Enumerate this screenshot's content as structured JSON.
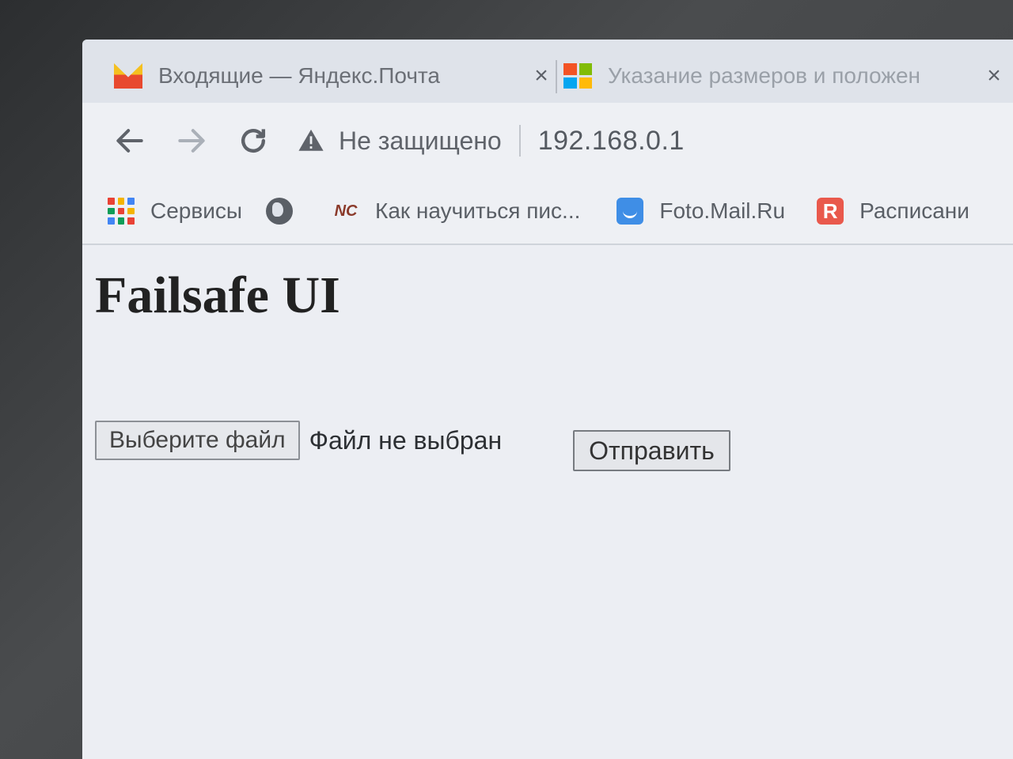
{
  "browser": {
    "tabs": [
      {
        "title": "Входящие — Яндекс.Почта",
        "close": "×",
        "favicon": "yandex-mail-icon"
      },
      {
        "title": "Указание размеров и положен",
        "close": "×",
        "favicon": "microsoft-icon"
      }
    ],
    "security_label": "Не защищено",
    "url": "192.168.0.1",
    "bookmarks": [
      {
        "label": "Сервисы",
        "icon": "apps-grid-icon"
      },
      {
        "label": "",
        "icon": "globe-icon"
      },
      {
        "label": "Как научиться пис...",
        "icon": "nc-logo-icon"
      },
      {
        "label": "Foto.Mail.Ru",
        "icon": "foto-mail-icon"
      },
      {
        "label": "Расписани",
        "icon": "r-icon"
      }
    ],
    "icon_glyphs": {
      "r": "R",
      "nc": "NC"
    }
  },
  "page": {
    "title": "Failsafe UI",
    "file_button": "Выберите файл",
    "file_status": "Файл не выбран",
    "submit_button": "Отправить"
  },
  "colors": {
    "yandex_yellow": "#f5c020",
    "yandex_red": "#e8492f",
    "foto_blue": "#3f8ee6",
    "r_red": "#e9594c"
  }
}
